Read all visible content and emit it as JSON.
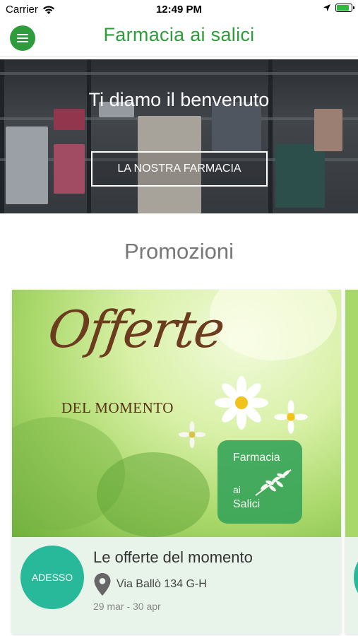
{
  "status_bar": {
    "carrier": "Carrier",
    "time": "12:49 PM",
    "battery_color": "#2dbb3b"
  },
  "app_bar": {
    "title": "Farmacia ai salici",
    "menu_icon": "hamburger-menu-icon",
    "accent_color": "#2e9b3c"
  },
  "hero": {
    "title": "Ti diamo il benvenuto",
    "button_label": "LA NOSTRA FARMACIA"
  },
  "promotions": {
    "section_title": "Promozioni",
    "cards": [
      {
        "image_headline": "Offerte",
        "image_subline": "DEL MOMENTO",
        "logo_line1": "Farmacia",
        "logo_line2": "ai",
        "logo_line3": "Salici",
        "badge": "ADESSO",
        "title": "Le offerte del momento",
        "address": "Via Ballò 134 G-H",
        "dates": "29 mar - 30 apr",
        "badge_color": "#28b99a"
      }
    ]
  }
}
